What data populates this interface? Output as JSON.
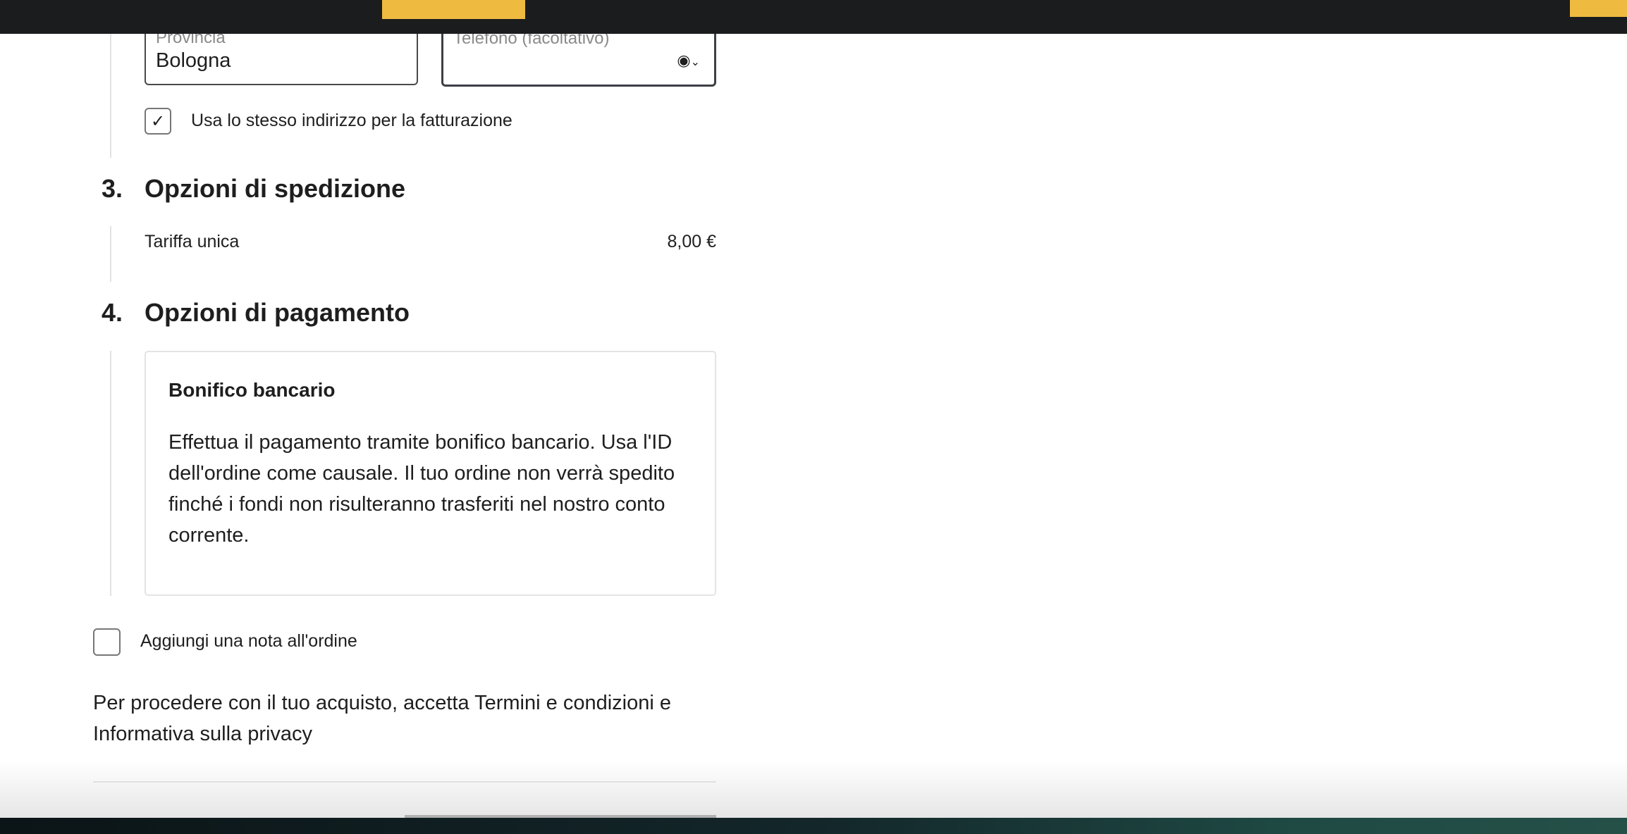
{
  "address": {
    "province_label": "Provincia",
    "province_value": "Bologna",
    "phone_label": "Telefono (facoltativo)",
    "same_billing_label": "Usa lo stesso indirizzo per la fatturazione",
    "same_billing_checked": true
  },
  "shipping": {
    "number": "3.",
    "title": "Opzioni di spedizione",
    "option": "Tariffa unica",
    "price": "8,00 €"
  },
  "payment": {
    "number": "4.",
    "title": "Opzioni di pagamento",
    "method": "Bonifico bancario",
    "description": "Effettua il pagamento tramite bonifico bancario. Usa l'ID dell'ordine come causale. Il tuo ordine non verrà spedito finché i fondi non risulteranno trasferiti nel nostro conto corrente."
  },
  "note": {
    "label": "Aggiungi una nota all'ordine",
    "checked": false
  },
  "terms": "Per procedere con il tuo acquisto, accetta Termini e condizioni e Informativa sulla privacy",
  "colors": {
    "accent": "#eeba40",
    "topbar": "#1b1c1e"
  }
}
